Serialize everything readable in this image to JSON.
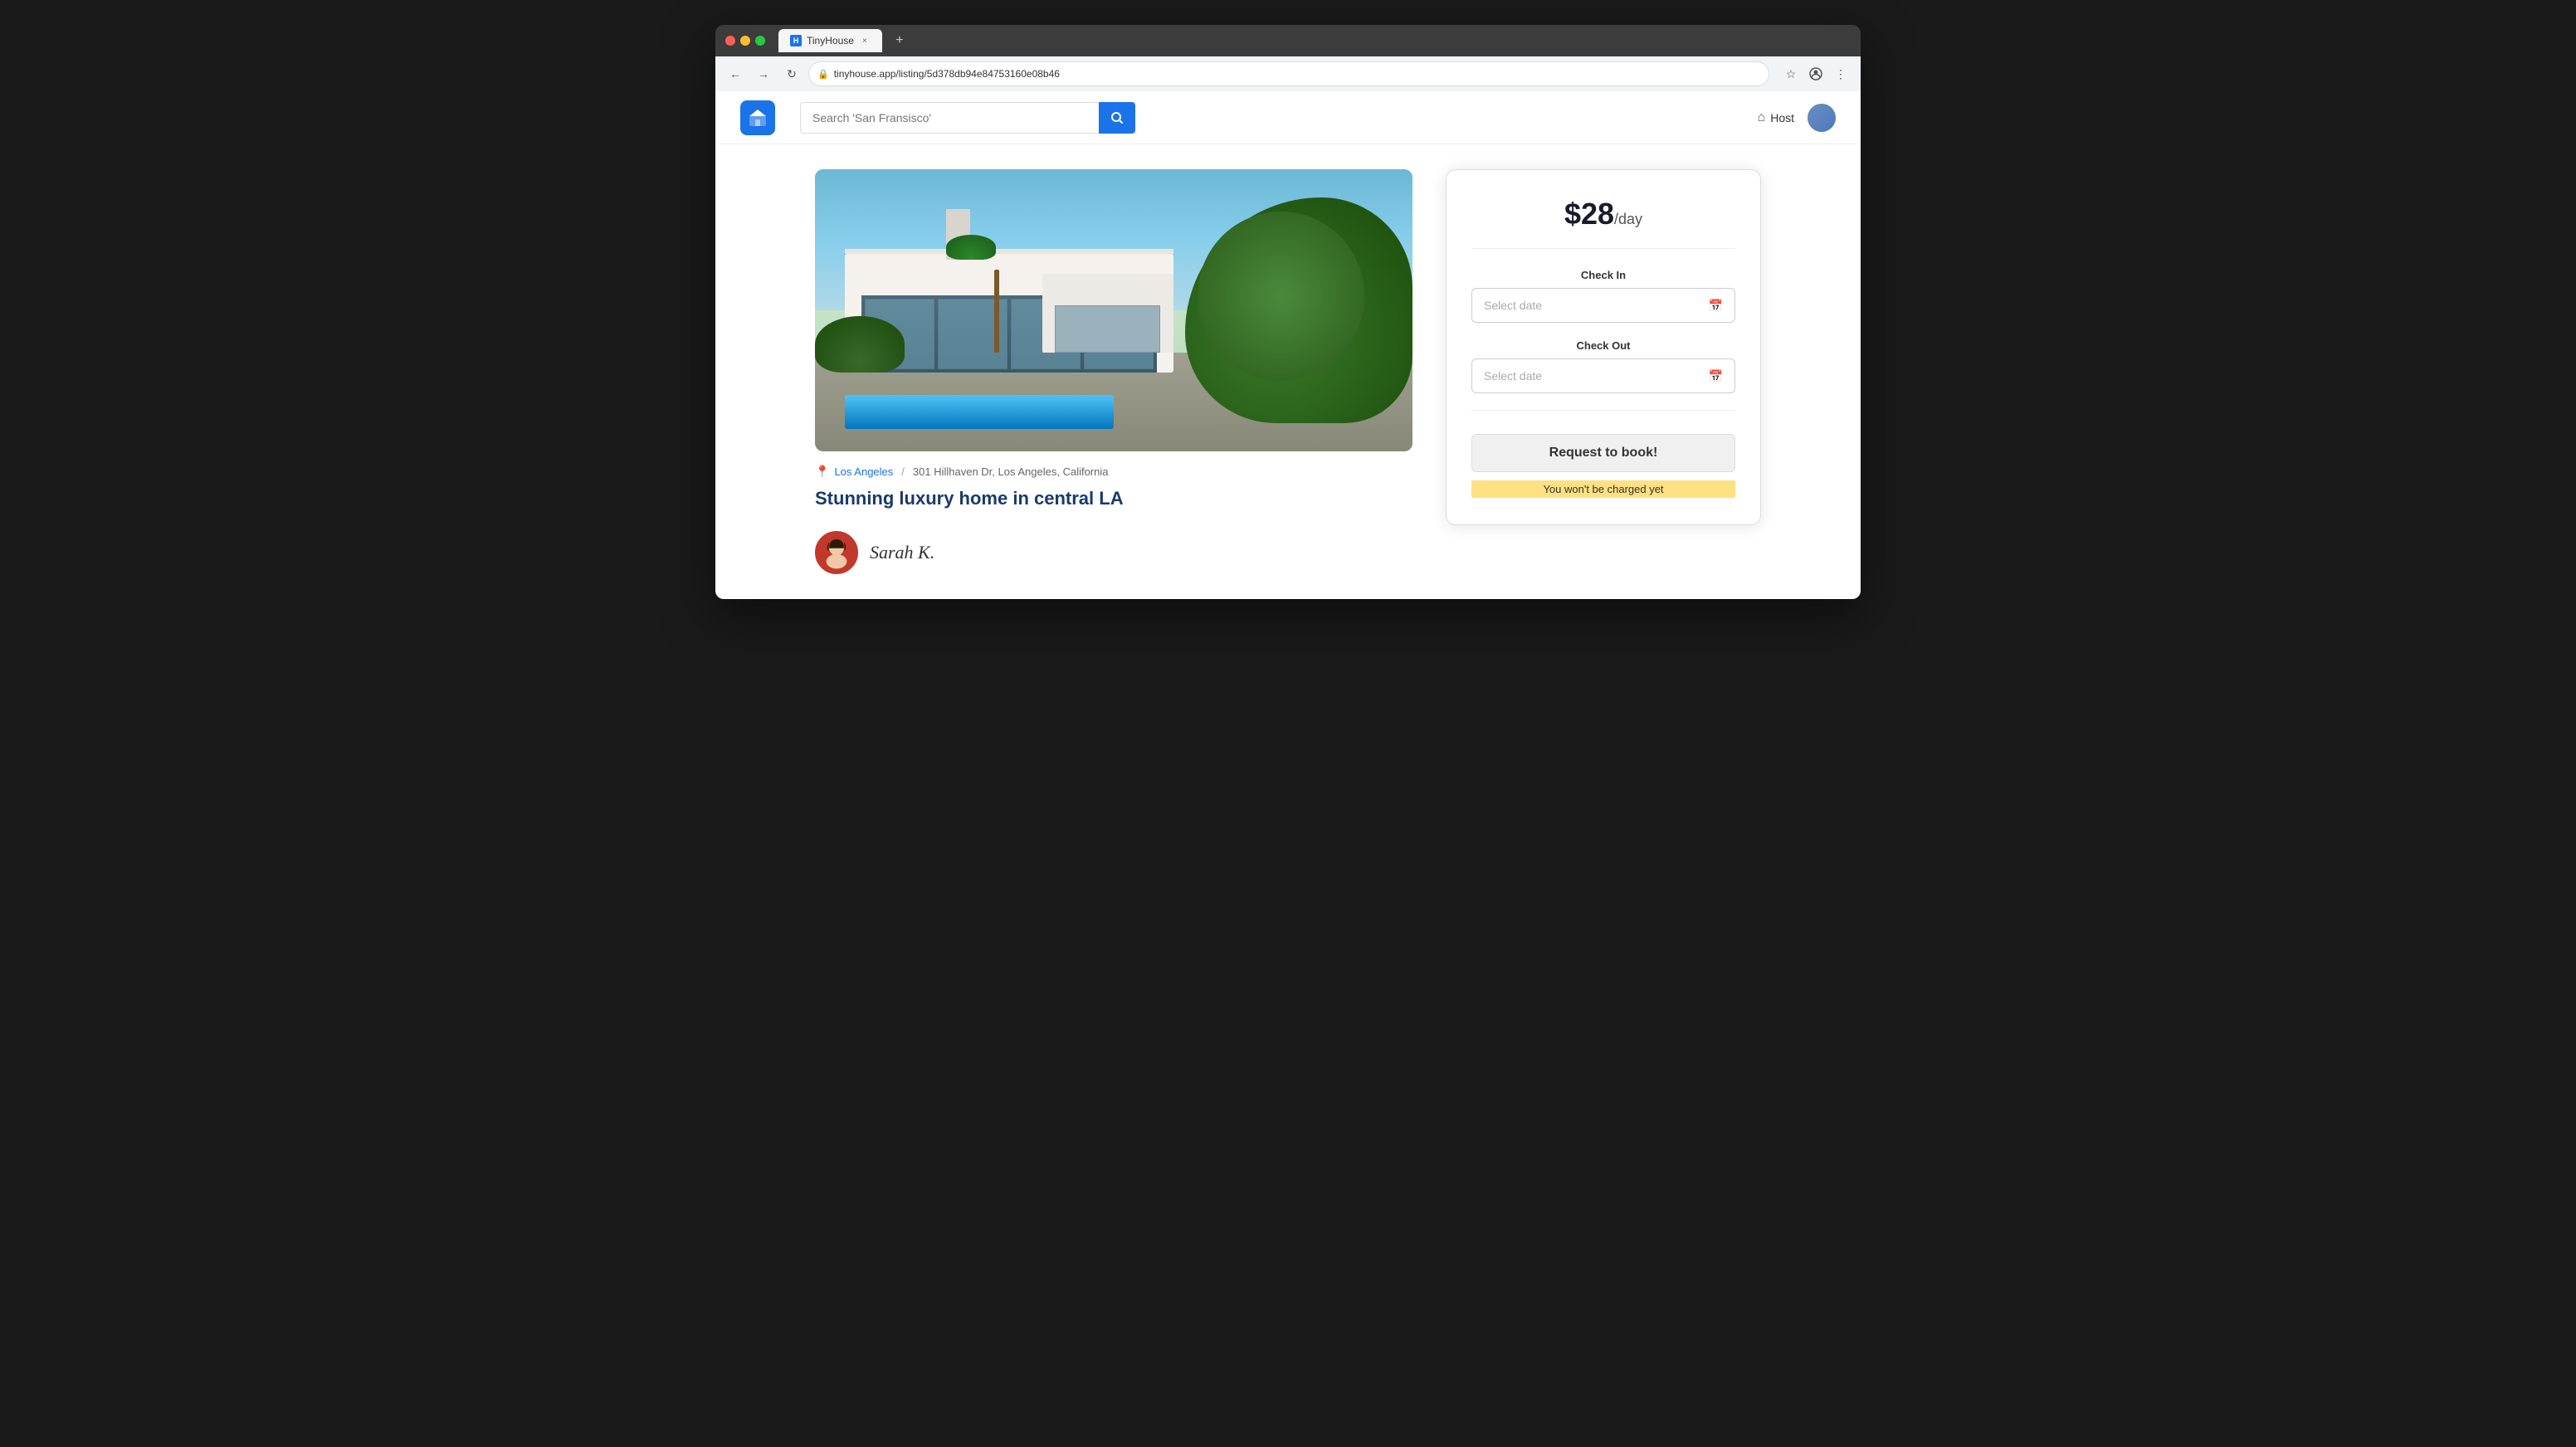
{
  "browser": {
    "tab_title": "TinyHouse",
    "tab_close": "×",
    "new_tab": "+",
    "address": "tinyhouse.app/listing/5d378db94e84753160e08b46",
    "back_icon": "←",
    "forward_icon": "→",
    "refresh_icon": "↻",
    "lock_icon": "🔒",
    "star_icon": "☆",
    "menu_icon": "⋮"
  },
  "nav": {
    "logo_letter": "H",
    "search_placeholder": "Search 'San Fransisco'",
    "search_icon": "🔍",
    "host_label": "Host",
    "house_icon": "⌂"
  },
  "listing": {
    "location_city": "Los Angeles",
    "location_separator": "/",
    "location_full": "301 Hillhaven Dr, Los Angeles, California",
    "title": "Stunning luxury home in central LA",
    "host_name": "Sarah K."
  },
  "booking": {
    "price_amount": "$28",
    "price_period": "/day",
    "checkin_label": "Check In",
    "checkin_placeholder": "Select date",
    "checkout_label": "Check Out",
    "checkout_placeholder": "Select date",
    "book_button": "Request to book!",
    "no_charge_text": "You won't be charged yet"
  }
}
